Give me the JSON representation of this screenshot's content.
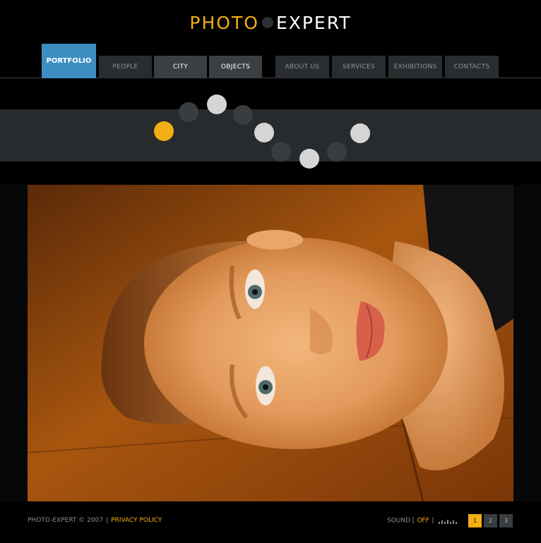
{
  "logo": {
    "part1": "PHOTO",
    "part2": "EXPERT"
  },
  "nav": {
    "portfolio": "PORTFOLIO",
    "items": [
      "PEOPLE",
      "CITY",
      "OBJECTS",
      "ABOUT US",
      "SERVICES",
      "EXHIBITIONS",
      "CONTACTS"
    ]
  },
  "footer": {
    "copyright": "PHOTO-EXPERT © 2007",
    "separator": "|",
    "privacy": "PRIVACY POLICY",
    "sound_label": "SOUND",
    "sound_open": "[",
    "sound_state": "OFF",
    "sound_close": "]",
    "pages": [
      "1",
      "2",
      "3"
    ]
  },
  "colors": {
    "accent": "#f2ae13",
    "brand_blue": "#3e8ec3"
  }
}
